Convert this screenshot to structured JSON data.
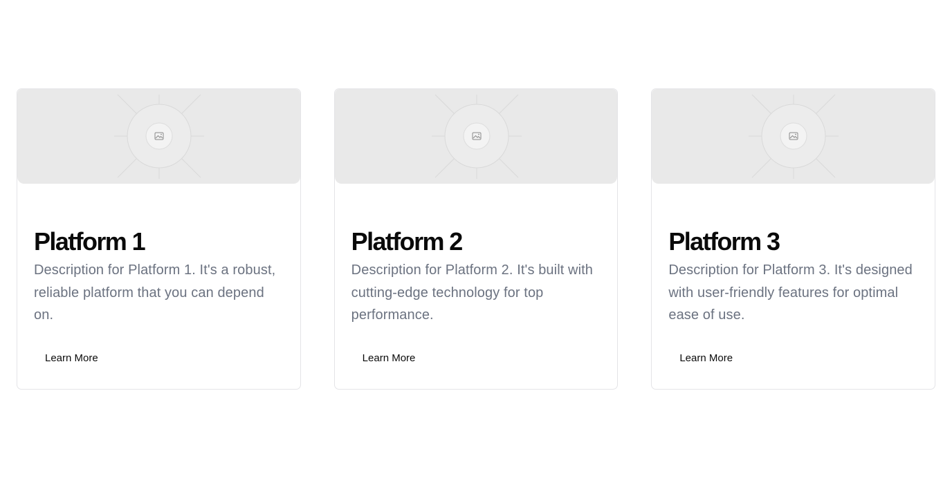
{
  "cards": [
    {
      "title": "Platform 1",
      "description": "Description for Platform 1. It's a robust, reliable platform that you can depend on.",
      "button_label": "Learn More",
      "image_icon": "image-placeholder-icon"
    },
    {
      "title": "Platform 2",
      "description": "Description for Platform 2. It's built with cutting-edge technology for top performance.",
      "button_label": "Learn More",
      "image_icon": "image-placeholder-icon"
    },
    {
      "title": "Platform 3",
      "description": "Description for Platform 3. It's designed with user-friendly features for optimal ease of use.",
      "button_label": "Learn More",
      "image_icon": "image-placeholder-icon"
    }
  ],
  "colors": {
    "title": "#0a0a0a",
    "description": "#6b7280",
    "placeholder_bg": "#e9e9e9",
    "card_border": "#e4e4e7"
  }
}
